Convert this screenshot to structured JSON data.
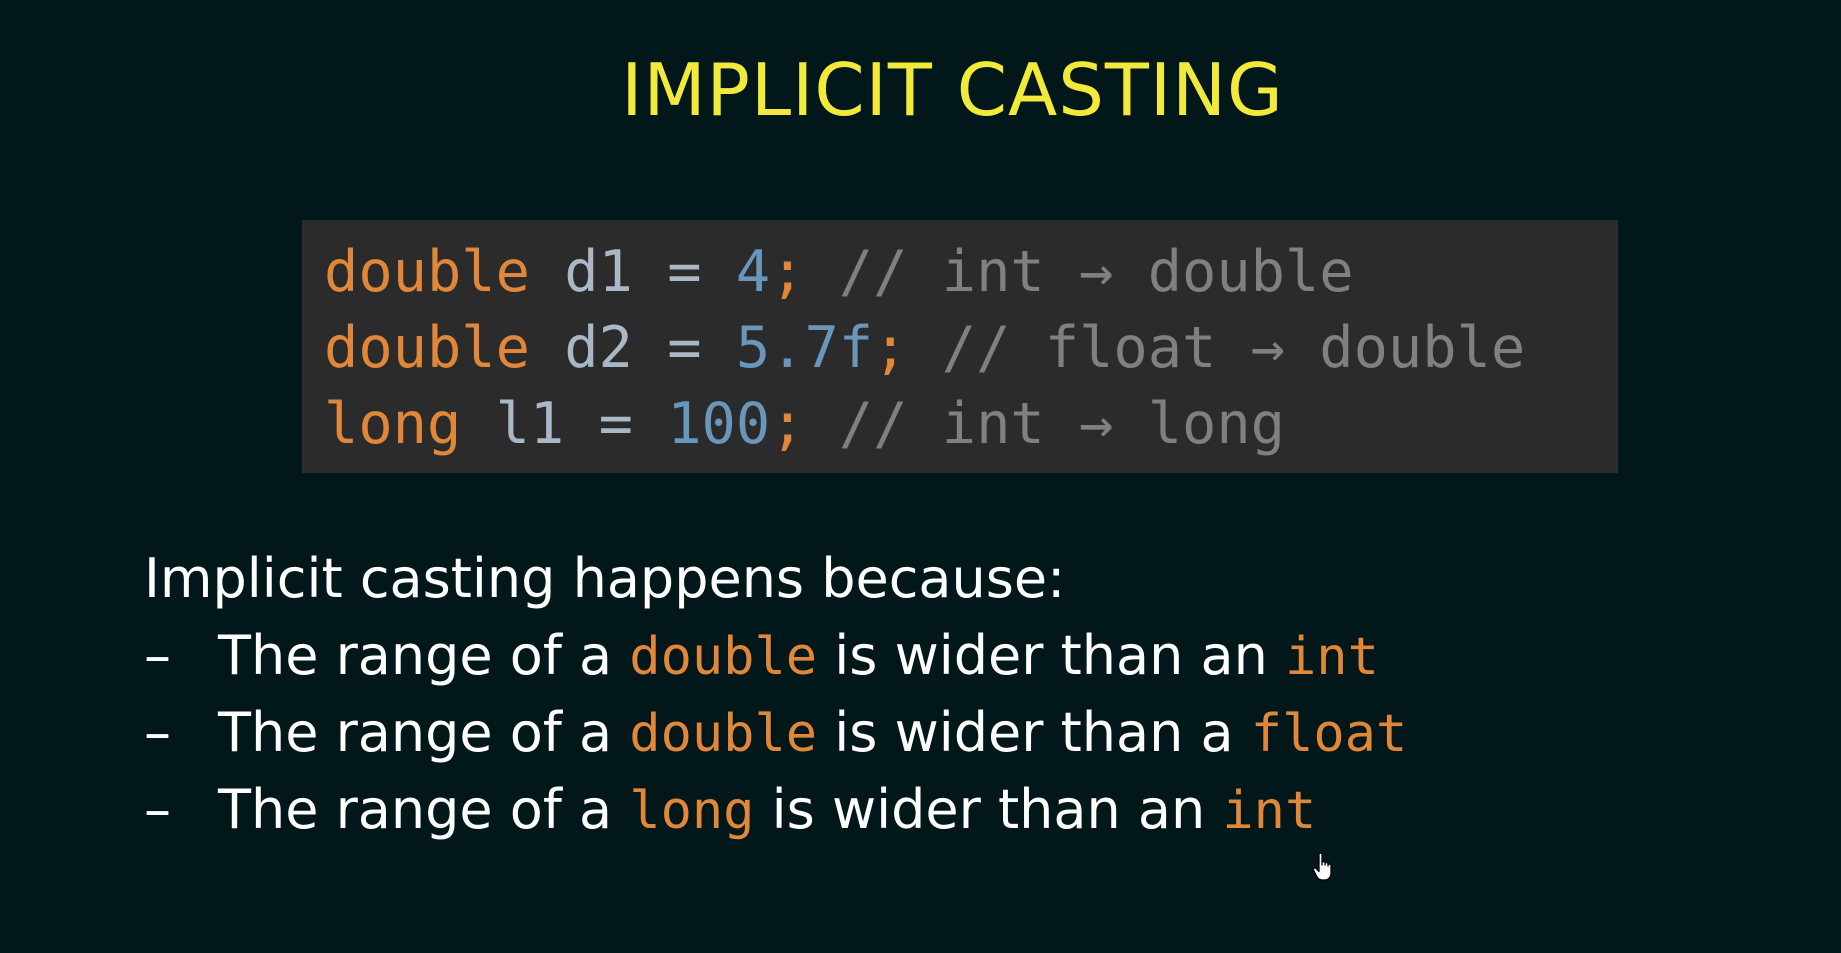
{
  "slide": {
    "title": "IMPLICIT CASTING",
    "code_lines": [
      {
        "type": "double",
        "name": "d1",
        "eq": "=",
        "value": "4",
        "semi": ";",
        "comment": "// int → double"
      },
      {
        "type": "double",
        "name": "d2",
        "eq": "=",
        "value": "5.7f",
        "semi": ";",
        "comment": "// float → double"
      },
      {
        "type": "long",
        "name": "l1",
        "eq": "=",
        "value": "100",
        "semi": ";",
        "comment": "// int → long"
      }
    ],
    "intro": "Implicit casting happens because:",
    "bullets": [
      {
        "dash": "–",
        "prefix": "The range of a",
        "wide_type": "double",
        "middle": "is wider than an",
        "narrow_type": "int"
      },
      {
        "dash": "–",
        "prefix": "The range of a",
        "wide_type": "double",
        "middle": "is wider than a",
        "narrow_type": "float"
      },
      {
        "dash": "–",
        "prefix": "The range of a",
        "wide_type": "long",
        "middle": "is wider than an",
        "narrow_type": "int"
      }
    ],
    "cursor_icon": "hand-pointer-icon"
  },
  "colors": {
    "background": "#021719",
    "title": "#f2ea3a",
    "keyword": "#e0873a",
    "number": "#6897bb",
    "comment": "#808080",
    "code_box": "#2b2b2b"
  }
}
